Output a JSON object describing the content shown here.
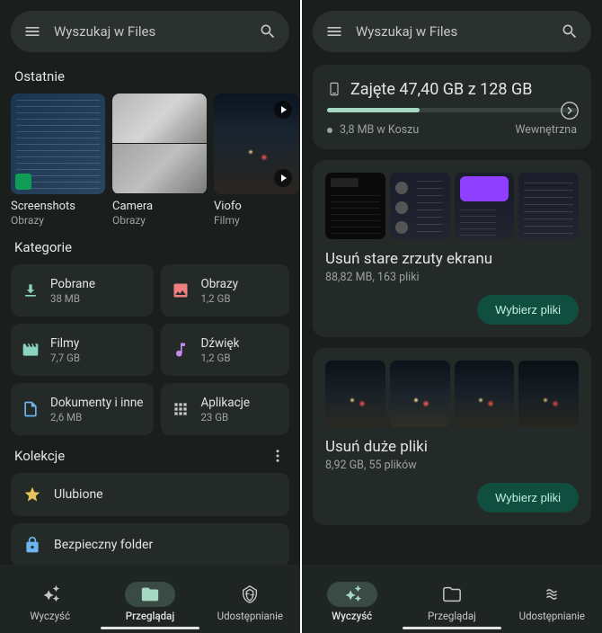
{
  "search_placeholder": "Wyszukaj w Files",
  "left": {
    "recent_title": "Ostatnie",
    "recent": [
      {
        "label": "Screenshots",
        "sub": "Obrazy"
      },
      {
        "label": "Camera",
        "sub": "Obrazy"
      },
      {
        "label": "Viofo",
        "sub": "Filmy"
      }
    ],
    "categories_title": "Kategorie",
    "categories": [
      {
        "label": "Pobrane",
        "sub": "38 MB",
        "icon": "download",
        "color": "#8bd4c1"
      },
      {
        "label": "Obrazy",
        "sub": "1,2 GB",
        "icon": "image",
        "color": "#f08080"
      },
      {
        "label": "Filmy",
        "sub": "7,7 GB",
        "icon": "movie",
        "color": "#8bd4c1"
      },
      {
        "label": "Dźwięk",
        "sub": "1,2 GB",
        "icon": "music",
        "color": "#c48bf0"
      },
      {
        "label": "Dokumenty i inne",
        "sub": "2,6 MB",
        "icon": "doc",
        "color": "#6db4f0"
      },
      {
        "label": "Aplikacje",
        "sub": "23 GB",
        "icon": "apps",
        "color": "#c5c9c6"
      }
    ],
    "collections_title": "Kolekcje",
    "collections": [
      {
        "label": "Ulubione",
        "icon": "star",
        "color": "#e8c25a"
      },
      {
        "label": "Bezpieczny folder",
        "icon": "lock",
        "color": "#6db4f0"
      }
    ]
  },
  "right": {
    "storage": {
      "title": "Zajęte 47,40 GB z 128 GB",
      "trash": "3,8 MB w Koszu",
      "internal": "Wewnętrzna"
    },
    "clean1": {
      "title": "Usuń stare zrzuty ekranu",
      "sub": "88,82 MB, 163 pliki",
      "button": "Wybierz pliki"
    },
    "clean2": {
      "title": "Usuń duże pliki",
      "sub": "8,92 GB, 55 plików",
      "button": "Wybierz pliki"
    }
  },
  "nav": {
    "clean": "Wyczyść",
    "browse": "Przeglądaj",
    "share": "Udostępnianie"
  }
}
